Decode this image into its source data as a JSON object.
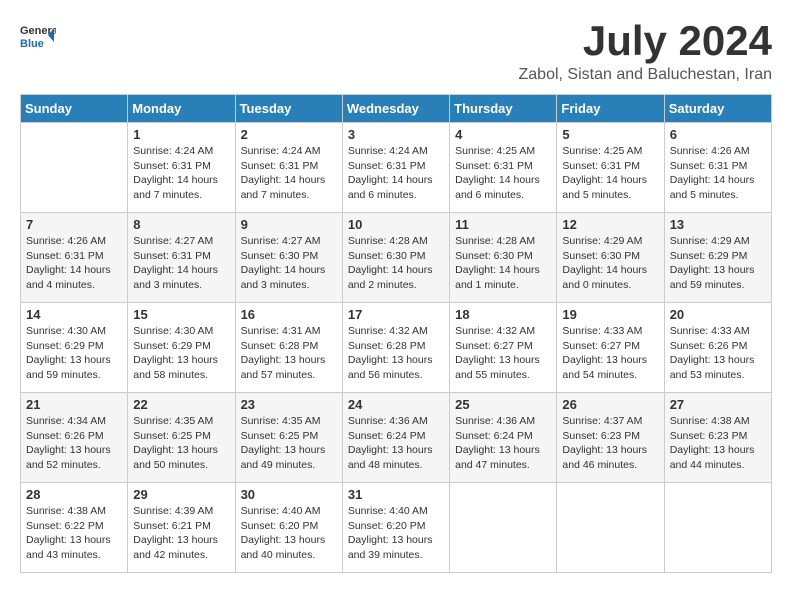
{
  "header": {
    "logo_general": "General",
    "logo_blue": "Blue",
    "month_title": "July 2024",
    "location": "Zabol, Sistan and Baluchestan, Iran"
  },
  "days_of_week": [
    "Sunday",
    "Monday",
    "Tuesday",
    "Wednesday",
    "Thursday",
    "Friday",
    "Saturday"
  ],
  "weeks": [
    [
      {
        "day": "",
        "text": ""
      },
      {
        "day": "1",
        "text": "Sunrise: 4:24 AM\nSunset: 6:31 PM\nDaylight: 14 hours\nand 7 minutes."
      },
      {
        "day": "2",
        "text": "Sunrise: 4:24 AM\nSunset: 6:31 PM\nDaylight: 14 hours\nand 7 minutes."
      },
      {
        "day": "3",
        "text": "Sunrise: 4:24 AM\nSunset: 6:31 PM\nDaylight: 14 hours\nand 6 minutes."
      },
      {
        "day": "4",
        "text": "Sunrise: 4:25 AM\nSunset: 6:31 PM\nDaylight: 14 hours\nand 6 minutes."
      },
      {
        "day": "5",
        "text": "Sunrise: 4:25 AM\nSunset: 6:31 PM\nDaylight: 14 hours\nand 5 minutes."
      },
      {
        "day": "6",
        "text": "Sunrise: 4:26 AM\nSunset: 6:31 PM\nDaylight: 14 hours\nand 5 minutes."
      }
    ],
    [
      {
        "day": "7",
        "text": "Sunrise: 4:26 AM\nSunset: 6:31 PM\nDaylight: 14 hours\nand 4 minutes."
      },
      {
        "day": "8",
        "text": "Sunrise: 4:27 AM\nSunset: 6:31 PM\nDaylight: 14 hours\nand 3 minutes."
      },
      {
        "day": "9",
        "text": "Sunrise: 4:27 AM\nSunset: 6:30 PM\nDaylight: 14 hours\nand 3 minutes."
      },
      {
        "day": "10",
        "text": "Sunrise: 4:28 AM\nSunset: 6:30 PM\nDaylight: 14 hours\nand 2 minutes."
      },
      {
        "day": "11",
        "text": "Sunrise: 4:28 AM\nSunset: 6:30 PM\nDaylight: 14 hours\nand 1 minute."
      },
      {
        "day": "12",
        "text": "Sunrise: 4:29 AM\nSunset: 6:30 PM\nDaylight: 14 hours\nand 0 minutes."
      },
      {
        "day": "13",
        "text": "Sunrise: 4:29 AM\nSunset: 6:29 PM\nDaylight: 13 hours\nand 59 minutes."
      }
    ],
    [
      {
        "day": "14",
        "text": "Sunrise: 4:30 AM\nSunset: 6:29 PM\nDaylight: 13 hours\nand 59 minutes."
      },
      {
        "day": "15",
        "text": "Sunrise: 4:30 AM\nSunset: 6:29 PM\nDaylight: 13 hours\nand 58 minutes."
      },
      {
        "day": "16",
        "text": "Sunrise: 4:31 AM\nSunset: 6:28 PM\nDaylight: 13 hours\nand 57 minutes."
      },
      {
        "day": "17",
        "text": "Sunrise: 4:32 AM\nSunset: 6:28 PM\nDaylight: 13 hours\nand 56 minutes."
      },
      {
        "day": "18",
        "text": "Sunrise: 4:32 AM\nSunset: 6:27 PM\nDaylight: 13 hours\nand 55 minutes."
      },
      {
        "day": "19",
        "text": "Sunrise: 4:33 AM\nSunset: 6:27 PM\nDaylight: 13 hours\nand 54 minutes."
      },
      {
        "day": "20",
        "text": "Sunrise: 4:33 AM\nSunset: 6:26 PM\nDaylight: 13 hours\nand 53 minutes."
      }
    ],
    [
      {
        "day": "21",
        "text": "Sunrise: 4:34 AM\nSunset: 6:26 PM\nDaylight: 13 hours\nand 52 minutes."
      },
      {
        "day": "22",
        "text": "Sunrise: 4:35 AM\nSunset: 6:25 PM\nDaylight: 13 hours\nand 50 minutes."
      },
      {
        "day": "23",
        "text": "Sunrise: 4:35 AM\nSunset: 6:25 PM\nDaylight: 13 hours\nand 49 minutes."
      },
      {
        "day": "24",
        "text": "Sunrise: 4:36 AM\nSunset: 6:24 PM\nDaylight: 13 hours\nand 48 minutes."
      },
      {
        "day": "25",
        "text": "Sunrise: 4:36 AM\nSunset: 6:24 PM\nDaylight: 13 hours\nand 47 minutes."
      },
      {
        "day": "26",
        "text": "Sunrise: 4:37 AM\nSunset: 6:23 PM\nDaylight: 13 hours\nand 46 minutes."
      },
      {
        "day": "27",
        "text": "Sunrise: 4:38 AM\nSunset: 6:23 PM\nDaylight: 13 hours\nand 44 minutes."
      }
    ],
    [
      {
        "day": "28",
        "text": "Sunrise: 4:38 AM\nSunset: 6:22 PM\nDaylight: 13 hours\nand 43 minutes."
      },
      {
        "day": "29",
        "text": "Sunrise: 4:39 AM\nSunset: 6:21 PM\nDaylight: 13 hours\nand 42 minutes."
      },
      {
        "day": "30",
        "text": "Sunrise: 4:40 AM\nSunset: 6:20 PM\nDaylight: 13 hours\nand 40 minutes."
      },
      {
        "day": "31",
        "text": "Sunrise: 4:40 AM\nSunset: 6:20 PM\nDaylight: 13 hours\nand 39 minutes."
      },
      {
        "day": "",
        "text": ""
      },
      {
        "day": "",
        "text": ""
      },
      {
        "day": "",
        "text": ""
      }
    ]
  ]
}
